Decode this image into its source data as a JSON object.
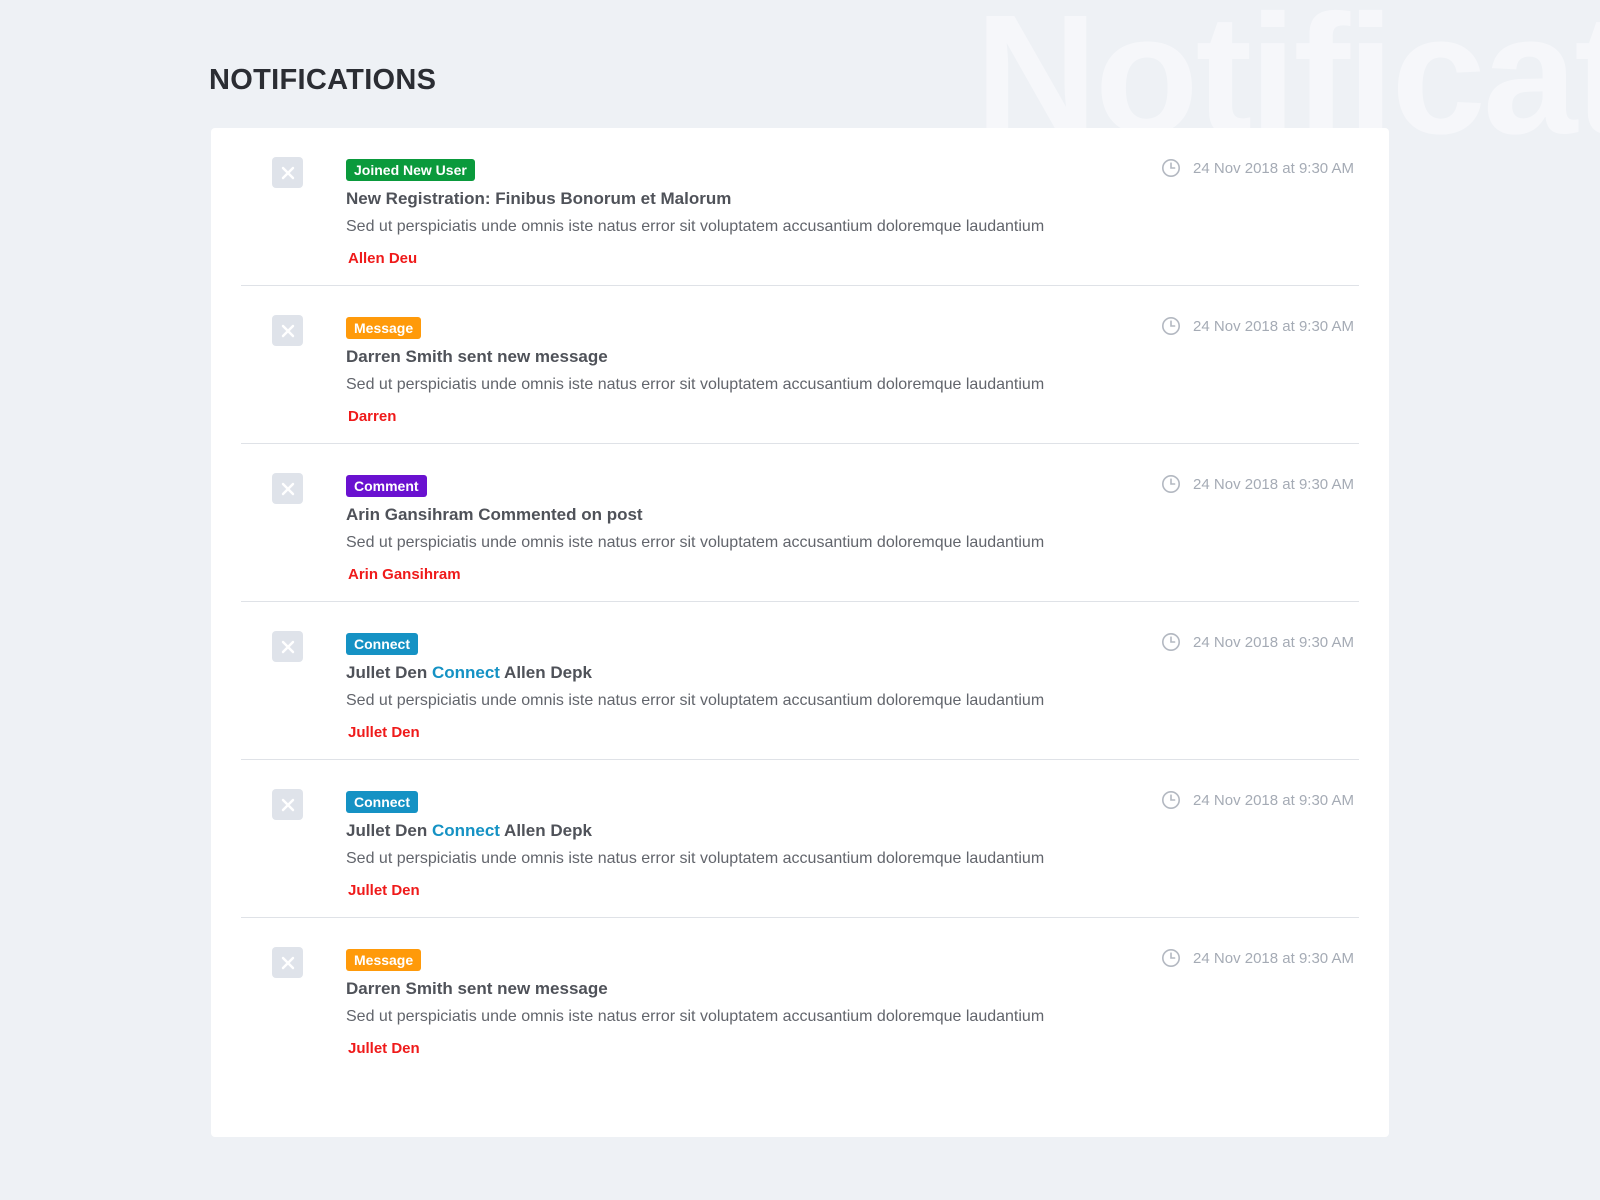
{
  "watermark": "Notificat",
  "page_title": "NOTIFICATIONS",
  "colors": {
    "green": "#0a9a3c",
    "orange": "#ff9a0a",
    "purple": "#6a11d0",
    "blue": "#1592c4",
    "author_red": "#ef1a1a"
  },
  "notifications": [
    {
      "tag": "Joined New User",
      "tag_color": "#0a9a3c",
      "title_before": "New Registration: Finibus Bonorum et Malorum",
      "title_highlight": "",
      "title_after": "",
      "description": "Sed ut perspiciatis unde omnis iste natus error sit voluptatem accusantium doloremque laudantium",
      "author": "Allen Deu",
      "time": "24 Nov 2018 at 9:30 AM",
      "close_icon": "close-icon",
      "time_icon": "clock-icon"
    },
    {
      "tag": "Message",
      "tag_color": "#ff9a0a",
      "title_before": "Darren Smith sent new message",
      "title_highlight": "",
      "title_after": "",
      "description": "Sed ut perspiciatis unde omnis iste natus error sit voluptatem accusantium doloremque laudantium",
      "author": "Darren",
      "time": "24 Nov 2018 at 9:30 AM",
      "close_icon": "close-icon",
      "time_icon": "clock-icon"
    },
    {
      "tag": "Comment",
      "tag_color": "#6a11d0",
      "title_before": "Arin Gansihram Commented on post",
      "title_highlight": "",
      "title_after": "",
      "description": "Sed ut perspiciatis unde omnis iste natus error sit voluptatem accusantium doloremque laudantium",
      "author": "Arin Gansihram",
      "time": "24 Nov 2018 at 9:30 AM",
      "close_icon": "close-icon",
      "time_icon": "clock-icon"
    },
    {
      "tag": "Connect",
      "tag_color": "#1592c4",
      "title_before": "Jullet Den ",
      "title_highlight": "Connect",
      "title_after": " Allen Depk",
      "description": "Sed ut perspiciatis unde omnis iste natus error sit voluptatem accusantium doloremque laudantium",
      "author": "Jullet Den",
      "time": "24 Nov 2018 at 9:30 AM",
      "close_icon": "close-icon",
      "time_icon": "clock-icon"
    },
    {
      "tag": "Connect",
      "tag_color": "#1592c4",
      "title_before": "Jullet Den ",
      "title_highlight": "Connect",
      "title_after": " Allen Depk",
      "description": "Sed ut perspiciatis unde omnis iste natus error sit voluptatem accusantium doloremque laudantium",
      "author": "Jullet Den",
      "time": "24 Nov 2018 at 9:30 AM",
      "close_icon": "close-icon",
      "time_icon": "clock-icon"
    },
    {
      "tag": "Message",
      "tag_color": "#ff9a0a",
      "title_before": "Darren Smith sent new message",
      "title_highlight": "",
      "title_after": "",
      "description": "Sed ut perspiciatis unde omnis iste natus error sit voluptatem accusantium doloremque laudantium",
      "author": "Jullet Den",
      "time": "24 Nov 2018 at 9:30 AM",
      "close_icon": "close-icon",
      "time_icon": "clock-icon"
    }
  ]
}
